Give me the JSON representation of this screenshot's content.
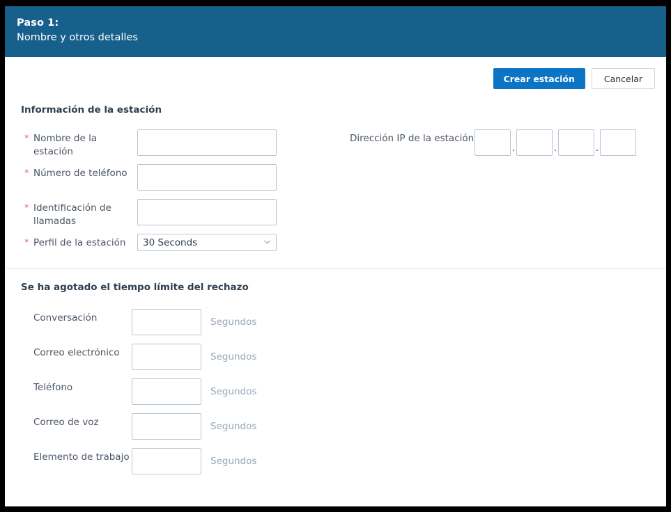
{
  "header": {
    "step_title": "Paso 1:",
    "step_subtitle": "Nombre y otros detalles",
    "background_color": "#17608c"
  },
  "actions": {
    "primary_label": "Crear estación",
    "primary_color": "#0b74c4",
    "secondary_label": "Cancelar"
  },
  "sections": [
    {
      "id": "station-information",
      "title": "Información de la estación",
      "left_fields": [
        {
          "label": "Nombre de la estación",
          "required": true,
          "type": "text",
          "value": ""
        },
        {
          "label": "Número de teléfono",
          "required": true,
          "type": "text",
          "value": ""
        },
        {
          "label": "Identificación de llamadas",
          "required": true,
          "type": "text",
          "value": ""
        },
        {
          "label": "Perfil de la estación",
          "required": true,
          "type": "select",
          "value": "30 Seconds",
          "options": [
            "30 Seconds"
          ]
        }
      ],
      "right_fields": [
        {
          "label": "Dirección IP de la estación",
          "required": false,
          "type": "ip",
          "separator": ".",
          "octets": [
            "",
            "",
            "",
            ""
          ]
        }
      ]
    },
    {
      "id": "rejection-timeout",
      "title": "Se ha agotado el tiempo límite del rechazo",
      "suffix": "Segundos",
      "fields": [
        {
          "label": "Conversación",
          "required": false,
          "type": "text",
          "value": ""
        },
        {
          "label": "Correo electrónico",
          "required": false,
          "type": "text",
          "value": ""
        },
        {
          "label": "Teléfono",
          "required": false,
          "type": "text",
          "value": ""
        },
        {
          "label": "Correo de voz",
          "required": false,
          "type": "text",
          "value": ""
        },
        {
          "label": "Elemento de trabajo",
          "required": false,
          "type": "text",
          "value": ""
        }
      ]
    }
  ],
  "icons": {
    "required_marker": "asterisk-icon",
    "select_arrow": "chevron-down-icon"
  }
}
